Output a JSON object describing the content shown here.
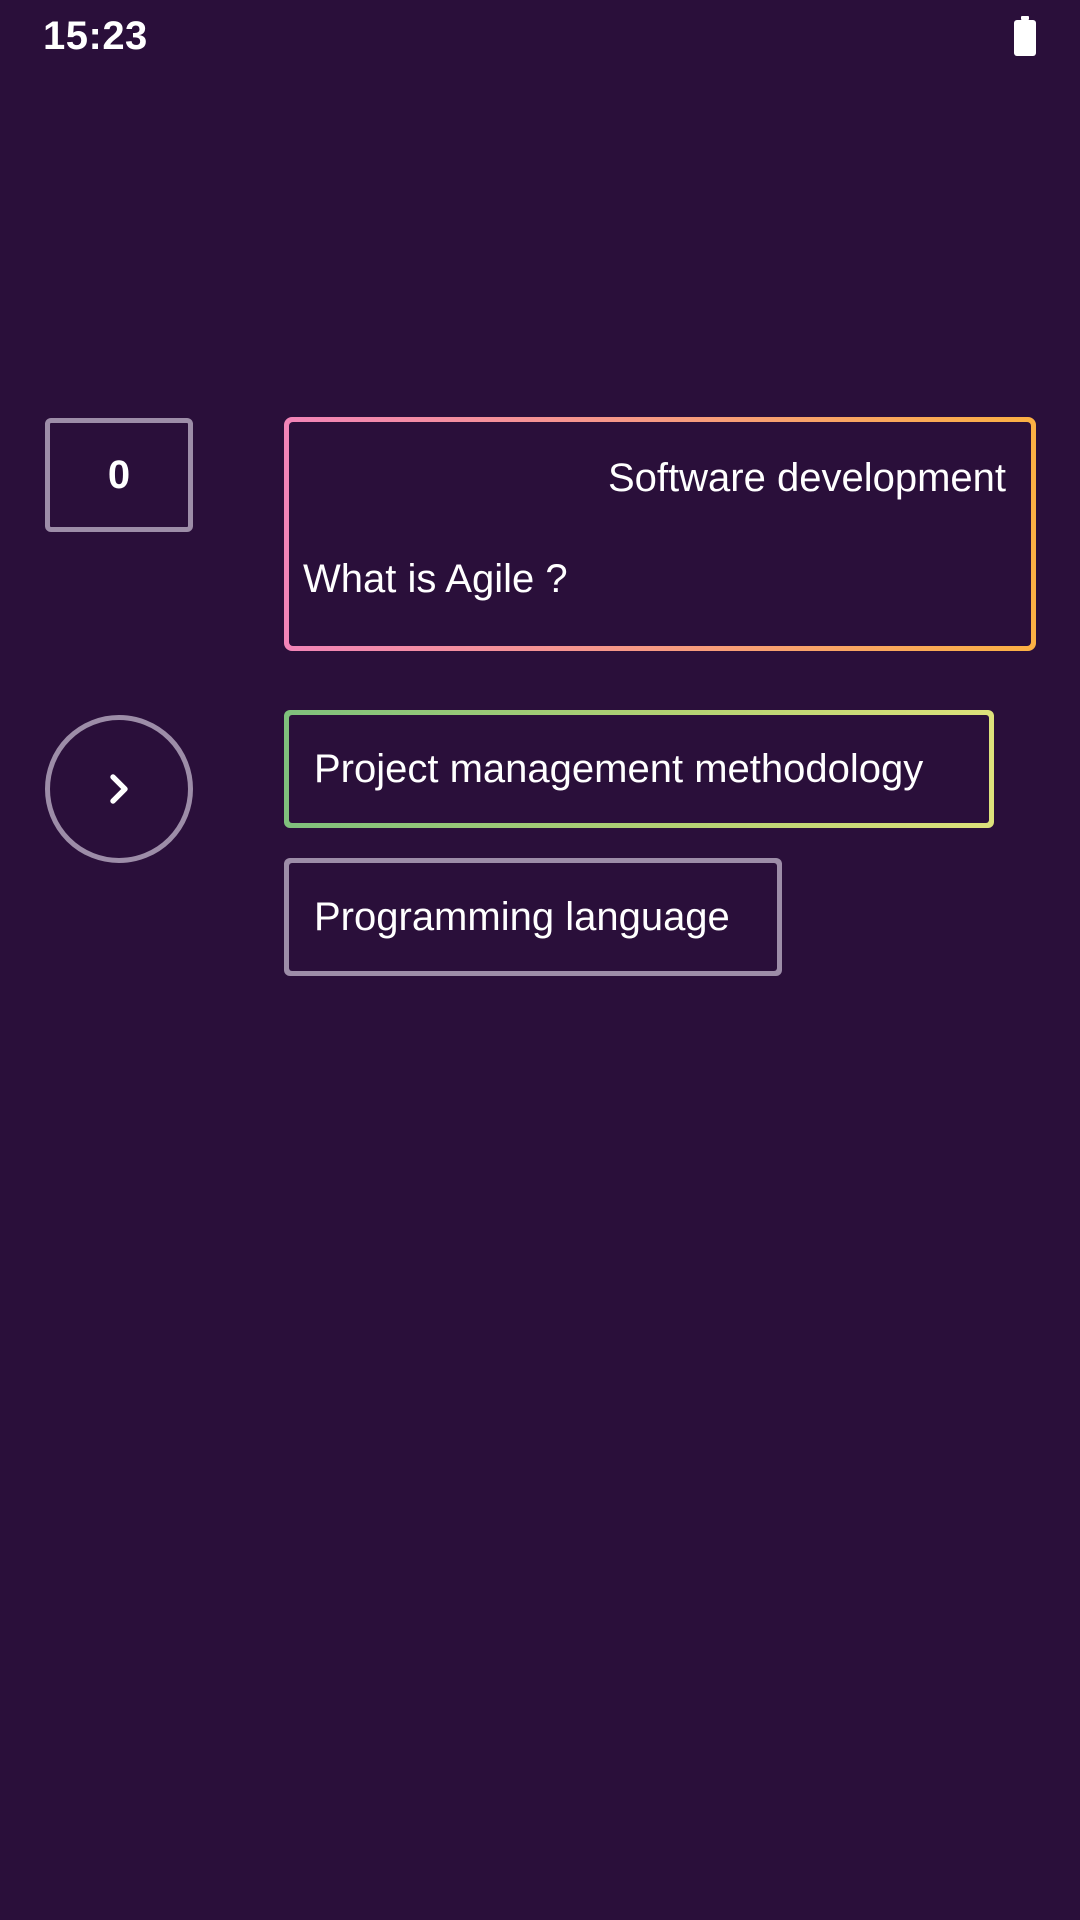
{
  "status_bar": {
    "time": "15:23",
    "battery_icon": "battery-full-icon"
  },
  "score": {
    "value": "0"
  },
  "next_button": {
    "icon": "chevron-right-icon"
  },
  "question": {
    "category": "Software development",
    "text": "What is Agile ?",
    "border_gradient": [
      "#f284b8",
      "#f79a82",
      "#fbb043"
    ]
  },
  "answers": [
    {
      "label": "Project management methodology",
      "border_gradient": [
        "#7fc07c",
        "#b3d173",
        "#dde17b"
      ]
    },
    {
      "label": "Programming language",
      "border_color": "#9d8da8"
    }
  ],
  "colors": {
    "background": "#2a0f3a",
    "neutral_border": "#9d8da8",
    "text": "#ffffff"
  }
}
